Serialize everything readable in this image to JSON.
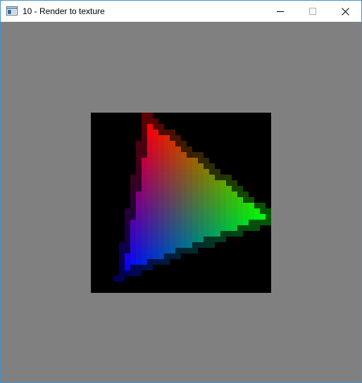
{
  "window": {
    "title": "10 - Render to texture",
    "icon": "application-window-icon",
    "controls": {
      "minimize_icon": "minimize-icon",
      "maximize_icon": "maximize-icon",
      "close_icon": "close-icon"
    }
  },
  "scene": {
    "clear_color": "#808080",
    "texture_background": "#000000",
    "texture_resolution": 32,
    "triangle": {
      "vertex_colors": [
        "#ff0000",
        "#00ff00",
        "#0000ff"
      ]
    }
  }
}
